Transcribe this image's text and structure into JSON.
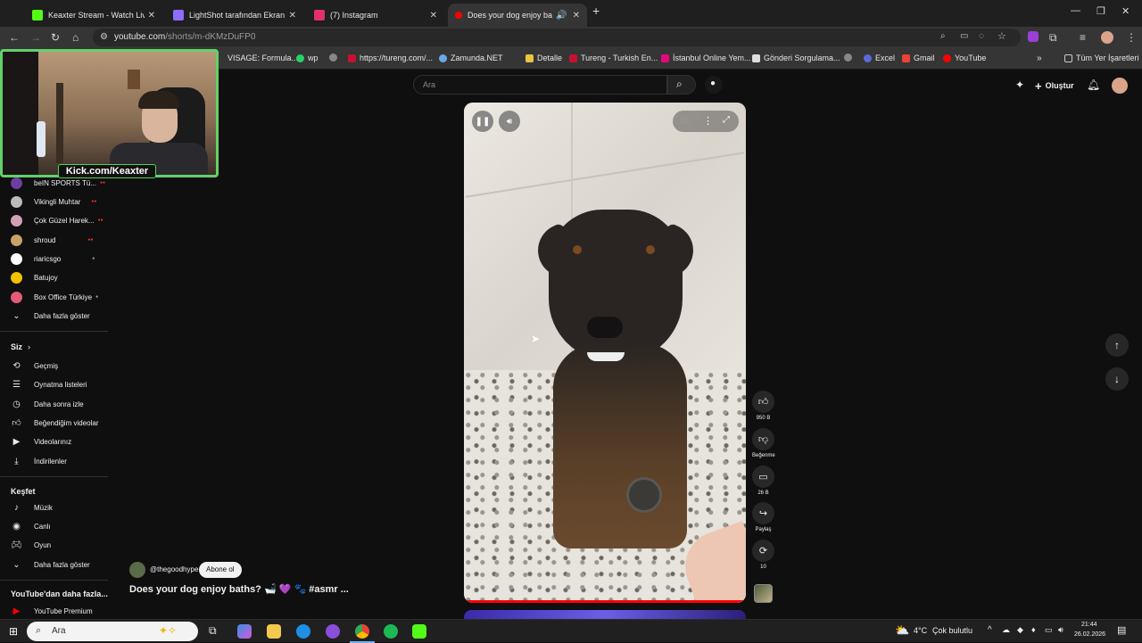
{
  "browser": {
    "tabs": [
      {
        "title": "Keaxter Stream - Watch Live on",
        "color": "#53fc18",
        "active": false
      },
      {
        "title": "LightShot tarafından Ekran Gön",
        "color": "#8e6cff",
        "active": false
      },
      {
        "title": "(7) Instagram",
        "color": "#e1306c",
        "active": false
      },
      {
        "title": "Does your dog enjoy baths",
        "color": "#ff0000",
        "active": true
      }
    ],
    "url_host": "youtube.com",
    "url_path": "/shorts/m-dKMzDuFP0",
    "bookmarks": [
      "VISAGE: Formula...",
      "wp",
      "https://tureng.com/...",
      "Zamunda.NET",
      "Detalle",
      "Tureng - Turkish En...",
      "İstanbul Online Yem...",
      "Gönderi Sorgulama...",
      "Excel",
      "Gmail",
      "YouTube"
    ],
    "all_bookmarks": "Tüm Yer İşaretleri"
  },
  "webcam": {
    "label": "Kick.com/Keaxter"
  },
  "header": {
    "search_placeholder": "Ara",
    "create_label": "Oluştur"
  },
  "sidebar": {
    "subscriptions": [
      {
        "name": "beIN SPORTS Tü...",
        "live": true,
        "color": "#6b3fa0"
      },
      {
        "name": "Vikingli Muhtar",
        "live": true,
        "color": "#bbbbbb"
      },
      {
        "name": "Çok Güzel Harek...",
        "live": true,
        "color": "#d4a0b8"
      },
      {
        "name": "shroud",
        "live": true,
        "color": "#c8a26a"
      },
      {
        "name": "riaricsgo",
        "live": false,
        "color": "#ffffff"
      },
      {
        "name": "Batujoy",
        "live": false,
        "color": "#f2c200"
      },
      {
        "name": "Box Office Türkiye",
        "live": false,
        "color": "#e55a7a"
      }
    ],
    "show_more": "Daha fazla göster",
    "you_heading": "Siz",
    "you_items": [
      {
        "label": "Geçmiş",
        "icon": "history-icon"
      },
      {
        "label": "Oynatma listeleri",
        "icon": "playlist-icon"
      },
      {
        "label": "Daha sonra izle",
        "icon": "clock-icon"
      },
      {
        "label": "Beğendiğim videolar",
        "icon": "like-icon"
      },
      {
        "label": "Videolarınız",
        "icon": "video-icon"
      },
      {
        "label": "İndirilenler",
        "icon": "download-icon"
      }
    ],
    "explore_heading": "Keşfet",
    "explore_items": [
      {
        "label": "Müzik",
        "icon": "music-icon"
      },
      {
        "label": "Canlı",
        "icon": "live-icon"
      },
      {
        "label": "Oyun",
        "icon": "gamepad-icon"
      }
    ],
    "explore_more": "Daha fazla göster",
    "more_heading": "YouTube'dan daha fazla...",
    "premium": "YouTube Premium"
  },
  "short": {
    "channel": "@thegoodhype",
    "subscribe": "Abone ol",
    "title": "Does your dog enjoy baths? 🛁 💜 🐾 #asmr ...",
    "likes": "950 B",
    "dislike_label": "Beğenme",
    "comments": "26 B",
    "share_label": "Paylaş",
    "remix_count": "10"
  },
  "taskbar": {
    "search_placeholder": "Ara",
    "temperature": "4°C",
    "weather": "Çok bulutlu",
    "time": "21:44",
    "date": "26.02.2026"
  },
  "colors": {
    "accent_red": "#ff0000",
    "kick_green": "#53fc18",
    "bg": "#0f0f0f"
  }
}
